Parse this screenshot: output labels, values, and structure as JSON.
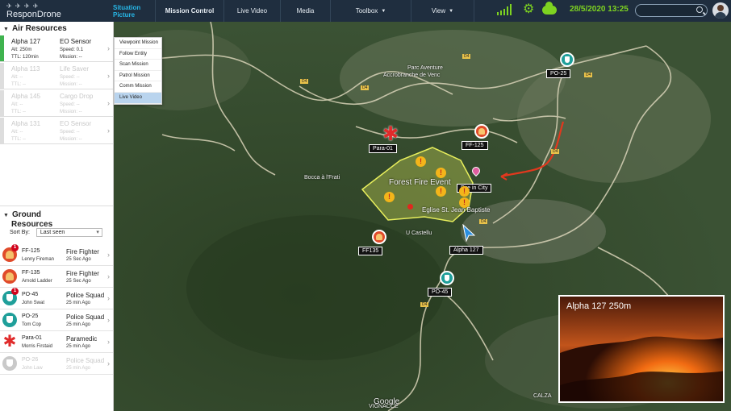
{
  "app": {
    "logo_line1": "✈ ✈ ✈ ✈",
    "brand": "ResponDrone"
  },
  "nav": [
    {
      "label": "Situation Picture",
      "state": "active"
    },
    {
      "label": "Mission Control",
      "state": "bold"
    },
    {
      "label": "Live Video",
      "state": "normal"
    },
    {
      "label": "Media",
      "state": "normal"
    },
    {
      "label": "Toolbox",
      "state": "dropdown"
    },
    {
      "label": "View",
      "state": "dropdown"
    }
  ],
  "status": {
    "datetime": "28/5/2020 13:25",
    "signal_icon": "signal-bars-icon",
    "settings_icon": "gear-icon",
    "cloud_icon": "cloud-icon",
    "accent": "#7ed321"
  },
  "air": {
    "title": "Air Resources",
    "items": [
      {
        "name": "Alpha 127",
        "sensor": "EO Sensor",
        "alt": "Alt: 250m",
        "speed": "Speed: 0.1",
        "ttl": "TTL: 120min",
        "mission": "Mission: --",
        "active": true
      },
      {
        "name": "Alpha 113",
        "sensor": "Life Saver",
        "alt": "Alt: --",
        "speed": "Speed: --",
        "ttl": "TTL: --",
        "mission": "Mission: --",
        "active": false
      },
      {
        "name": "Alpha 145",
        "sensor": "Cargo Drop",
        "alt": "Alt: --",
        "speed": "Speed: --",
        "ttl": "TTL: --",
        "mission": "Mission: --",
        "active": false
      },
      {
        "name": "Alpha 131",
        "sensor": "EO Sensor",
        "alt": "Alt: --",
        "speed": "Speed: --",
        "ttl": "TTL: --",
        "mission": "Mission: --",
        "active": false
      }
    ]
  },
  "context_menu": {
    "items": [
      "Viewpoint Mission",
      "Follow Entity",
      "Scan Mission",
      "Patrol Mission",
      "Comm Mission",
      "Live Video"
    ],
    "selected": "Live Video"
  },
  "ground": {
    "title_line1": "Ground",
    "title_line2": "Resources",
    "sort_label": "Sort By:",
    "sort_value": "Last seen",
    "items": [
      {
        "id": "FF-125",
        "person": "Lenny Fireman",
        "type": "Fire Fighter",
        "time": "25 Sec Ago",
        "icon": "fire",
        "badge": "1"
      },
      {
        "id": "FF-135",
        "person": "Arnold Ladder",
        "type": "Fire Fighter",
        "time": "25 Sec Ago",
        "icon": "fire",
        "badge": ""
      },
      {
        "id": "PO-45",
        "person": "John Swat",
        "type": "Police Squad",
        "time": "25 min Ago",
        "icon": "police",
        "badge": "1"
      },
      {
        "id": "PO-25",
        "person": "Tom Cop",
        "type": "Police Squad",
        "time": "25 min Ago",
        "icon": "police",
        "badge": ""
      },
      {
        "id": "Para-01",
        "person": "Morris Firstaid",
        "type": "Paramedic",
        "time": "25 min Ago",
        "icon": "para",
        "badge": ""
      },
      {
        "id": "PO-26",
        "person": "John Law",
        "type": "Police Squad",
        "time": "25 min Ago",
        "icon": "grey",
        "badge": ""
      }
    ]
  },
  "map": {
    "unit_labels": {
      "po25": "PO-25",
      "ff125": "FF-125",
      "para01": "Para-01",
      "fire_city": "Fire in City",
      "alpha127": "Alpha 127",
      "ff135": "FF135",
      "po45": "PO-45"
    },
    "event_label": "Forest Fire Event",
    "place_names": {
      "parc": "Parc Aventure",
      "accro": "Accrobranche de Venc",
      "bocca": "Bocca à l'Frati",
      "eglise": "Eglise St. Jean Baptiste",
      "castellu": "U Castellu",
      "calza": "CALZA",
      "vignacce": "VIGNACCE"
    },
    "road_badges": [
      "D4",
      "D4",
      "D4",
      "D4",
      "D4",
      "D4",
      "D4"
    ],
    "google": "Google"
  },
  "video": {
    "title": "Alpha 127  250m"
  }
}
